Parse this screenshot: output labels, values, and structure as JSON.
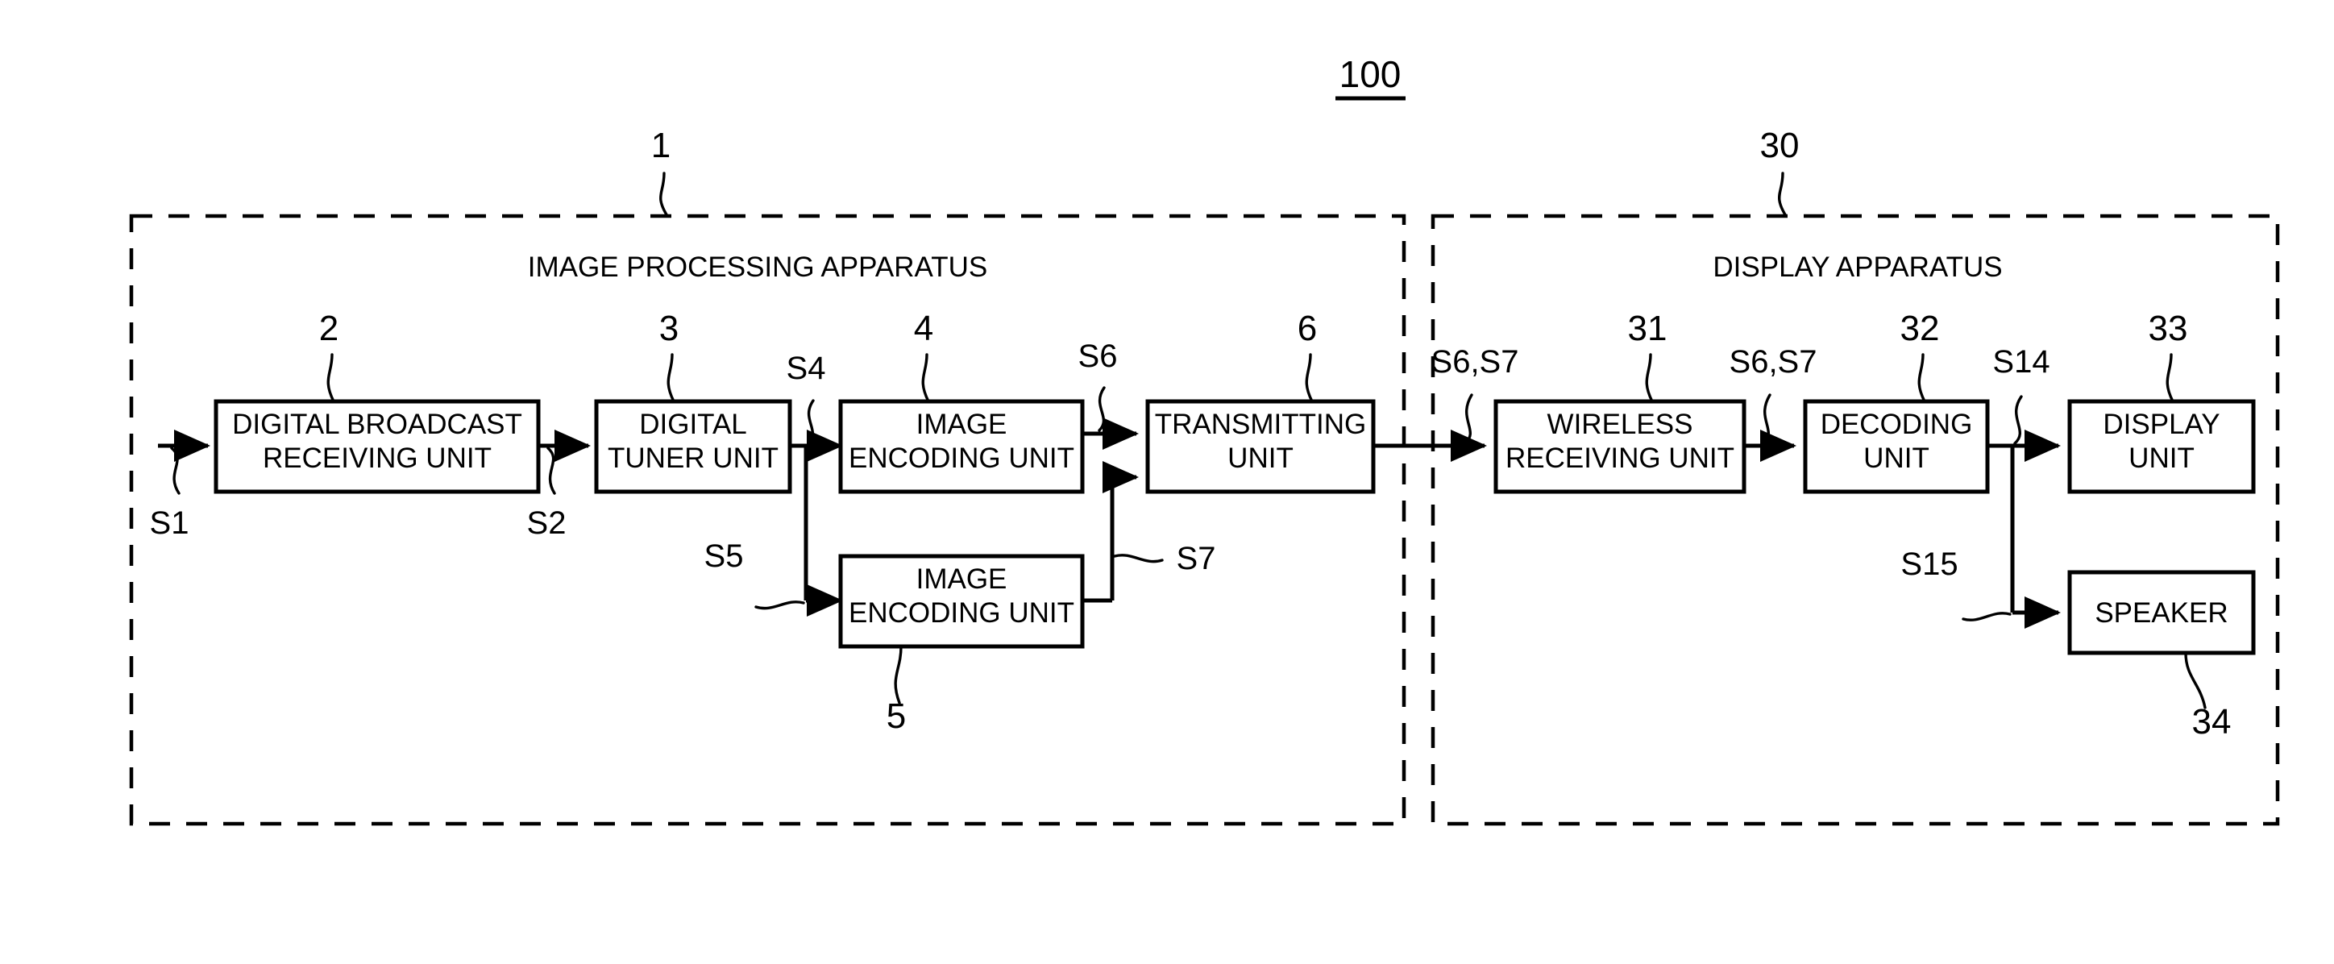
{
  "figure": {
    "number": "100",
    "underlined": true
  },
  "groups": [
    {
      "id": "image-processing-apparatus",
      "label": "IMAGE PROCESSING APPARATUS",
      "ref": "1"
    },
    {
      "id": "display-apparatus",
      "label": "DISPLAY APPARATUS",
      "ref": "30"
    }
  ],
  "blocks": [
    {
      "id": "digital-broadcast-receiving-unit",
      "lines": [
        "DIGITAL BROADCAST",
        "RECEIVING UNIT"
      ],
      "ref": "2"
    },
    {
      "id": "digital-tuner-unit",
      "lines": [
        "DIGITAL",
        "TUNER UNIT"
      ],
      "ref": "3"
    },
    {
      "id": "image-encoding-unit-upper",
      "lines": [
        "IMAGE",
        "ENCODING UNIT"
      ],
      "ref": "4"
    },
    {
      "id": "image-encoding-unit-lower",
      "lines": [
        "IMAGE",
        "ENCODING UNIT"
      ],
      "ref": "5"
    },
    {
      "id": "transmitting-unit",
      "lines": [
        "TRANSMITTING",
        "UNIT"
      ],
      "ref": "6"
    },
    {
      "id": "wireless-receiving-unit",
      "lines": [
        "WIRELESS",
        "RECEIVING UNIT"
      ],
      "ref": "31"
    },
    {
      "id": "decoding-unit",
      "lines": [
        "DECODING",
        "UNIT"
      ],
      "ref": "32"
    },
    {
      "id": "display-unit",
      "lines": [
        "DISPLAY",
        "UNIT"
      ],
      "ref": "33"
    },
    {
      "id": "speaker",
      "lines": [
        "SPEAKER"
      ],
      "ref": "34"
    }
  ],
  "signals": [
    {
      "id": "s1",
      "label": "S1"
    },
    {
      "id": "s2",
      "label": "S2"
    },
    {
      "id": "s4",
      "label": "S4"
    },
    {
      "id": "s5",
      "label": "S5"
    },
    {
      "id": "s6",
      "label": "S6"
    },
    {
      "id": "s7",
      "label": "S7"
    },
    {
      "id": "s6s7-left",
      "label": "S6,S7"
    },
    {
      "id": "s6s7-right",
      "label": "S6,S7"
    },
    {
      "id": "s14",
      "label": "S14"
    },
    {
      "id": "s15",
      "label": "S15"
    }
  ],
  "colors": {
    "ink": "#000000",
    "paper": "#ffffff"
  }
}
